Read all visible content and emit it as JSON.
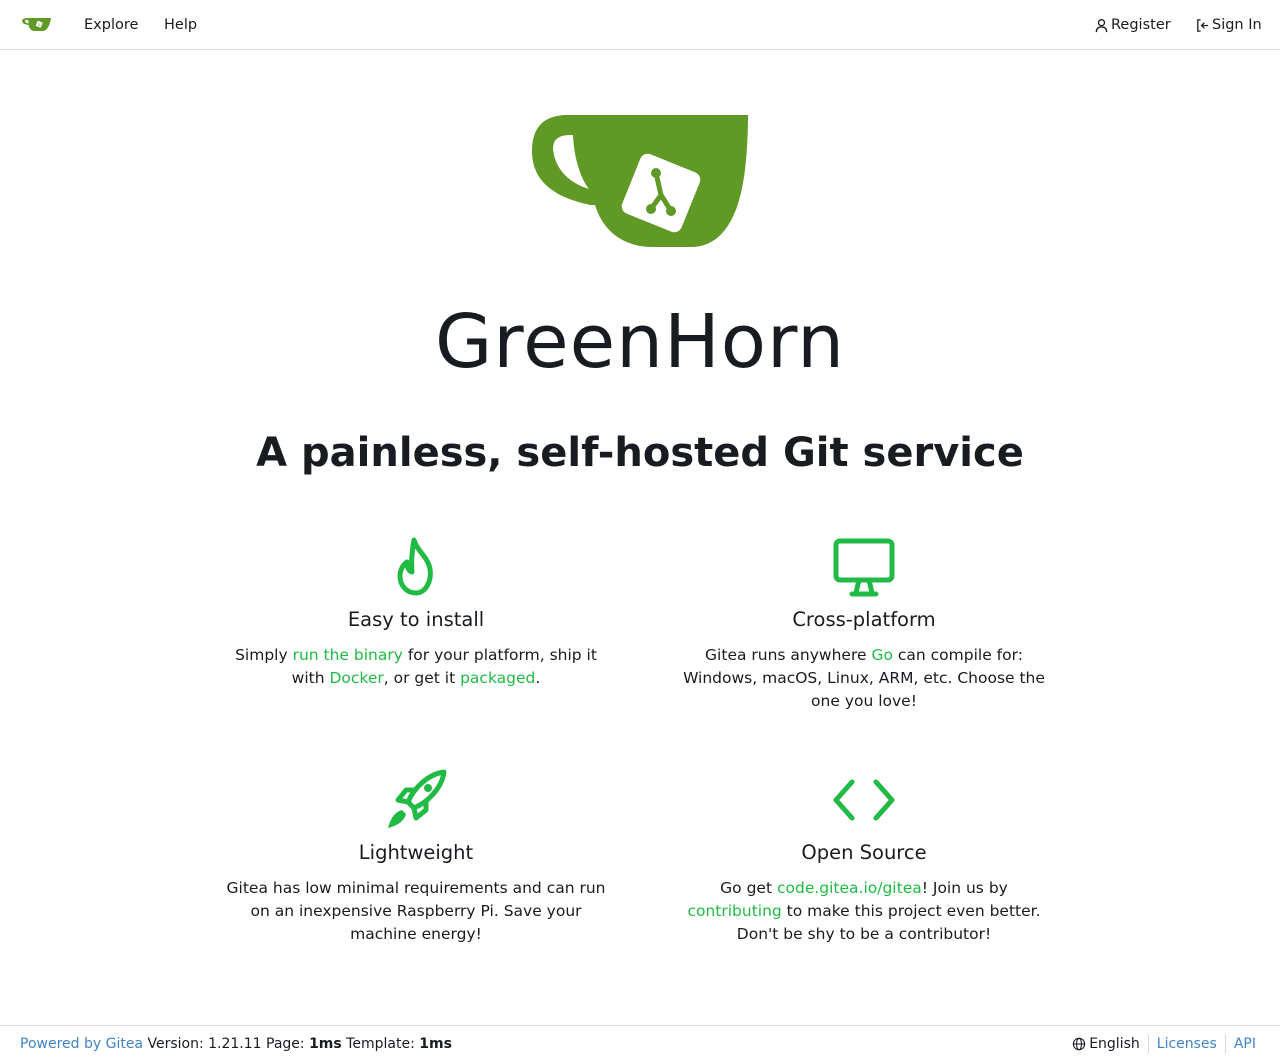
{
  "navbar": {
    "explore_label": "Explore",
    "help_label": "Help",
    "register_label": "Register",
    "signin_label": "Sign In"
  },
  "hero": {
    "title": "GreenHorn",
    "tagline": "A painless, self-hosted Git service"
  },
  "features": [
    {
      "icon": "flame-icon",
      "heading": "Easy to install",
      "text_1": "Simply ",
      "link_1": "run the binary",
      "text_2": " for your platform, ship it with ",
      "link_2": "Docker",
      "text_3": ", or get it ",
      "link_3": "packaged",
      "text_4": "."
    },
    {
      "icon": "device-desktop-icon",
      "heading": "Cross-platform",
      "text_1": "Gitea runs anywhere ",
      "link_1": "Go",
      "text_2": " can compile for: Windows, macOS, Linux, ARM, etc. Choose the one you love!"
    },
    {
      "icon": "rocket-icon",
      "heading": "Lightweight",
      "text_1": "Gitea has low minimal requirements and can run on an inexpensive Raspberry Pi. Save your machine energy!"
    },
    {
      "icon": "code-icon",
      "heading": "Open Source",
      "text_1": "Go get ",
      "link_1": "code.gitea.io/gitea",
      "text_2": "! Join us by ",
      "link_2": "contributing",
      "text_3": " to make this project even better. Don't be shy to be a contributor!"
    }
  ],
  "footer": {
    "powered_by": "Powered by Gitea",
    "version_label": " Version: 1.21.11 Page: ",
    "page_time": "1ms",
    "template_label": " Template: ",
    "template_time": "1ms",
    "language": "English",
    "licenses_label": "Licenses",
    "api_label": "API"
  },
  "colors": {
    "brand_green": "#609926",
    "feature_green": "#21ba45",
    "footer_link": "#4183c4"
  }
}
